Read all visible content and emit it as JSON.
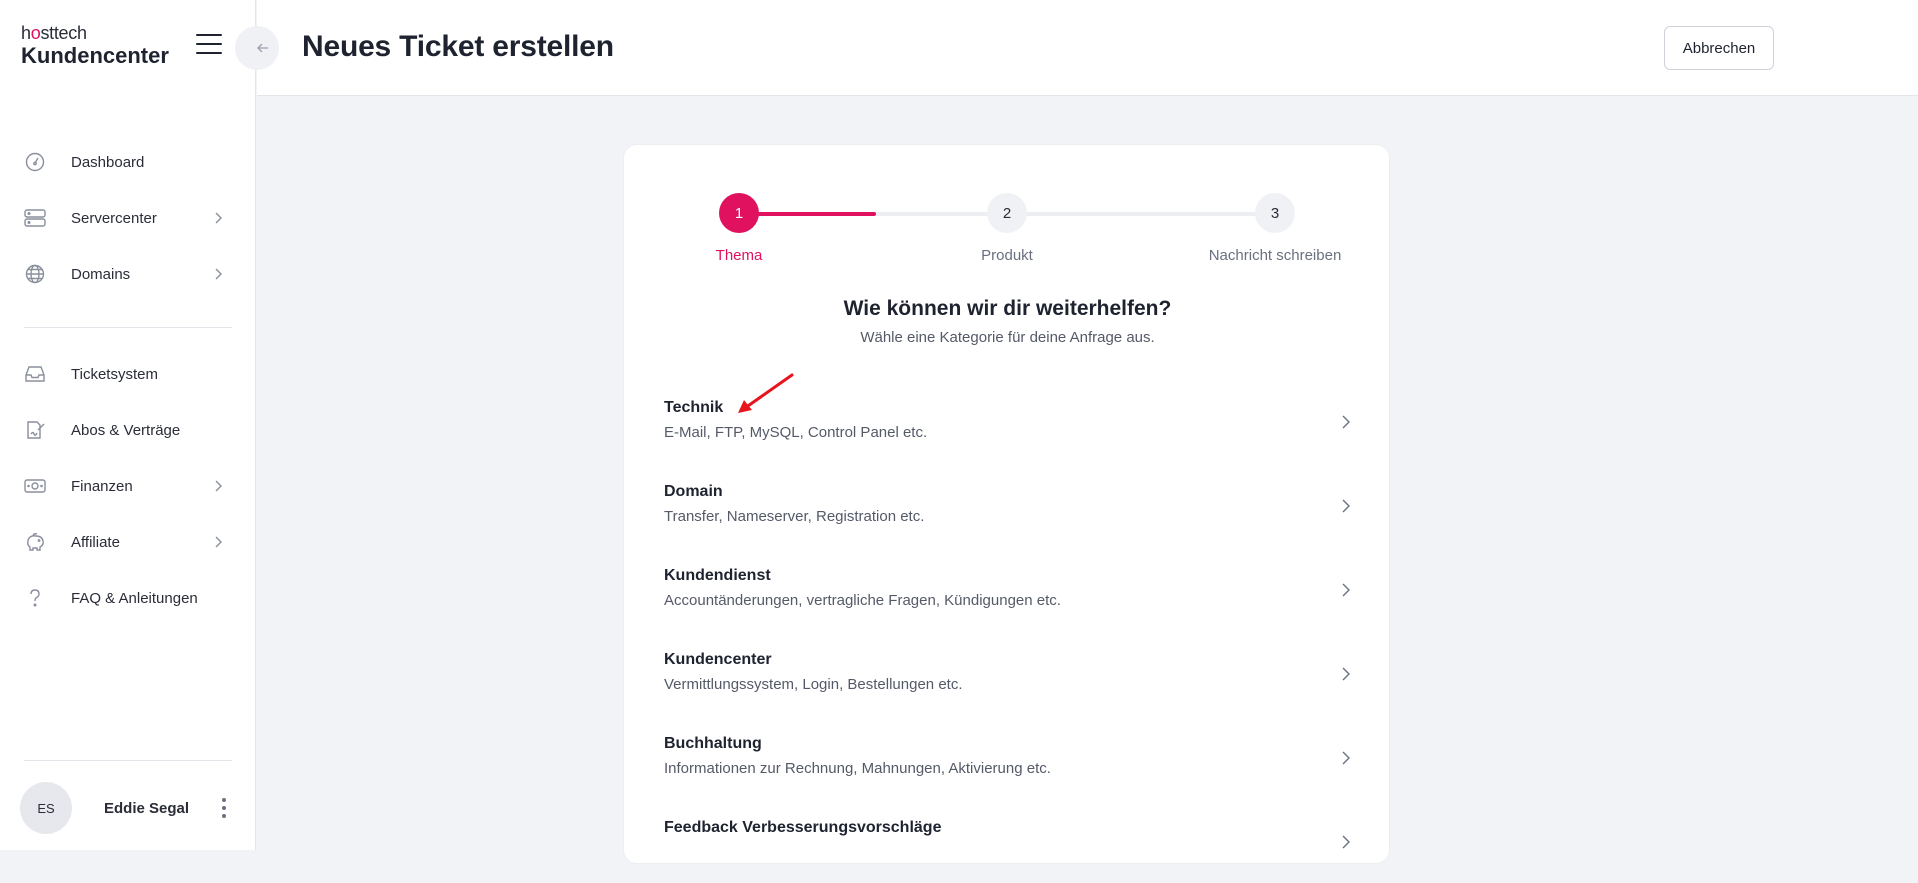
{
  "app": {
    "brand": "hosttech",
    "brand_pre": "h",
    "brand_o": "o",
    "brand_post": "sttech",
    "product": "Kundencenter"
  },
  "sidebar": {
    "items": [
      {
        "label": "Dashboard",
        "icon": "gauge-icon",
        "has_chevron": false
      },
      {
        "label": "Servercenter",
        "icon": "server-icon",
        "has_chevron": true
      },
      {
        "label": "Domains",
        "icon": "globe-icon",
        "has_chevron": true
      },
      {
        "label": "Ticketsystem",
        "icon": "inbox-icon",
        "has_chevron": false
      },
      {
        "label": "Abos & Verträge",
        "icon": "contract-icon",
        "has_chevron": false
      },
      {
        "label": "Finanzen",
        "icon": "money-icon",
        "has_chevron": true
      },
      {
        "label": "Affiliate",
        "icon": "piggy-bank-icon",
        "has_chevron": true
      },
      {
        "label": "FAQ & Anleitungen",
        "icon": "question-icon",
        "has_chevron": false
      }
    ],
    "user": {
      "initials": "ES",
      "name": "Eddie Segal"
    }
  },
  "header": {
    "title": "Neues Ticket erstellen",
    "cancel_label": "Abbrechen"
  },
  "stepper": {
    "steps": [
      {
        "number": "1",
        "label": "Thema",
        "active": true
      },
      {
        "number": "2",
        "label": "Produkt",
        "active": false
      },
      {
        "number": "3",
        "label": "Nachricht schreiben",
        "active": false
      }
    ]
  },
  "main": {
    "question": "Wie können wir dir weiterhelfen?",
    "subtitle": "Wähle eine Kategorie für deine Anfrage aus.",
    "categories": [
      {
        "title": "Technik",
        "description": "E-Mail, FTP, MySQL, Control Panel etc."
      },
      {
        "title": "Domain",
        "description": "Transfer, Nameserver, Registration etc."
      },
      {
        "title": "Kundendienst",
        "description": "Accountänderungen, vertragliche Fragen, Kündigungen etc."
      },
      {
        "title": "Kundencenter",
        "description": "Vermittlungssystem, Login, Bestellungen etc."
      },
      {
        "title": "Buchhaltung",
        "description": "Informationen zur Rechnung, Mahnungen, Aktivierung etc."
      },
      {
        "title": "Feedback Verbesserungsvorschläge",
        "description": ""
      }
    ]
  },
  "colors": {
    "accent": "#e0115f",
    "annotation_arrow": "#e8141c"
  }
}
